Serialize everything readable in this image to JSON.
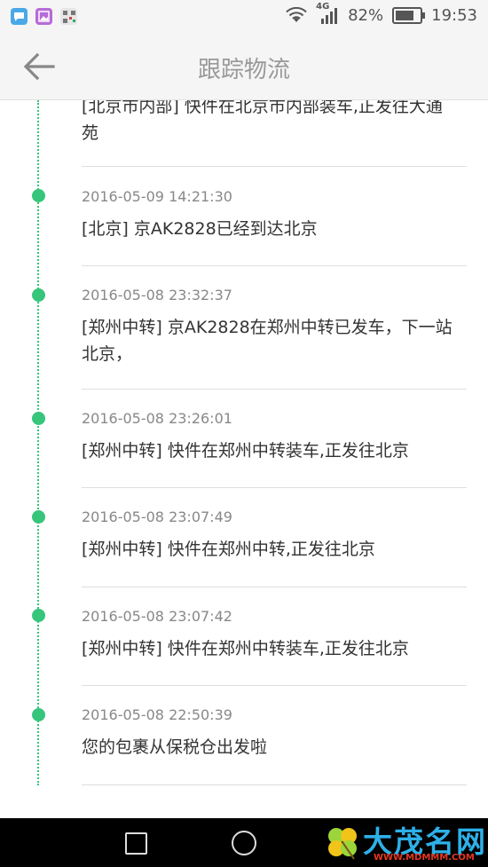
{
  "status_bar": {
    "network": "4G",
    "battery": "82%",
    "battery_level": 0.82,
    "time": "19:53"
  },
  "header": {
    "title": "跟踪物流",
    "back_icon": "arrow-left-icon"
  },
  "tracking": {
    "partial": {
      "message": "[北京市内部] 快件在北京市内部装车,正发往大通苑"
    },
    "entries": [
      {
        "time": "2016-05-09 14:21:30",
        "message": "[北京] 京AK2828已经到达北京"
      },
      {
        "time": "2016-05-08 23:32:37",
        "message": "[郑州中转] 京AK2828在郑州中转已发车，下一站北京，"
      },
      {
        "time": "2016-05-08 23:26:01",
        "message": "[郑州中转] 快件在郑州中转装车,正发往北京"
      },
      {
        "time": "2016-05-08 23:07:49",
        "message": "[郑州中转] 快件在郑州中转,正发往北京"
      },
      {
        "time": "2016-05-08 23:07:42",
        "message": "[郑州中转] 快件在郑州中转装车,正发往北京"
      },
      {
        "time": "2016-05-08 22:50:39",
        "message": "您的包裹从保税仓出发啦"
      }
    ]
  },
  "watermark": {
    "text": "大茂名网",
    "url": "WWW.MDMMM.COM"
  },
  "colors": {
    "accent": "#36c57a",
    "watermark_text": "#2db0e8",
    "watermark_url": "#e8371f"
  }
}
